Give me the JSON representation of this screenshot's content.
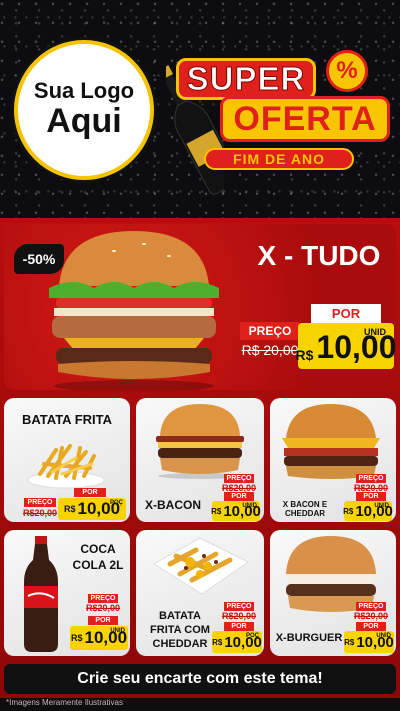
{
  "header": {
    "logo_line1": "Sua Logo",
    "logo_line2": "Aqui",
    "title_super": "SUPER",
    "percent_symbol": "%",
    "title_oferta": "OFERTA",
    "subtitle": "FIM DE ANO"
  },
  "featured": {
    "discount": "-50%",
    "name": "X - TUDO",
    "old_label": "PREÇO",
    "old_price": "R$ 20,00",
    "new_label": "POR",
    "currency": "R$",
    "price": "10,00",
    "unit": "UNID"
  },
  "products": [
    {
      "name": "BATATA FRITA",
      "old_label": "PREÇO",
      "old_price": "R$20,00",
      "new_label": "POR",
      "currency": "R$",
      "price": "10,00",
      "unit": "POÇ"
    },
    {
      "name": "X-BACON",
      "old_label": "PREÇO",
      "old_price": "R$20,00",
      "new_label": "POR",
      "currency": "R$",
      "price": "10,00",
      "unit": "UNID"
    },
    {
      "name": "X BACON E CHEDDAR",
      "old_label": "PREÇO",
      "old_price": "R$20,00",
      "new_label": "POR",
      "currency": "R$",
      "price": "10,00",
      "unit": "UNID"
    },
    {
      "name": "COCA COLA 2L",
      "old_label": "PREÇO",
      "old_price": "R$20,00",
      "new_label": "POR",
      "currency": "R$",
      "price": "10,00",
      "unit": "UNID"
    },
    {
      "name": "BATATA FRITA COM CHEDDAR",
      "old_label": "PREÇO",
      "old_price": "R$20,00",
      "new_label": "POR",
      "currency": "R$",
      "price": "10,00",
      "unit": "POÇ"
    },
    {
      "name": "X-BURGUER",
      "old_label": "PREÇO",
      "old_price": "R$20,00",
      "new_label": "POR",
      "currency": "R$",
      "price": "10,00",
      "unit": "UNID"
    }
  ],
  "footer": {
    "cta": "Crie seu encarte com este tema!",
    "disclaimer": "*Imagens Meramente Ilustrativas"
  },
  "colors": {
    "red": "#e0201b",
    "yellow": "#f7d400",
    "dark": "#111111"
  }
}
